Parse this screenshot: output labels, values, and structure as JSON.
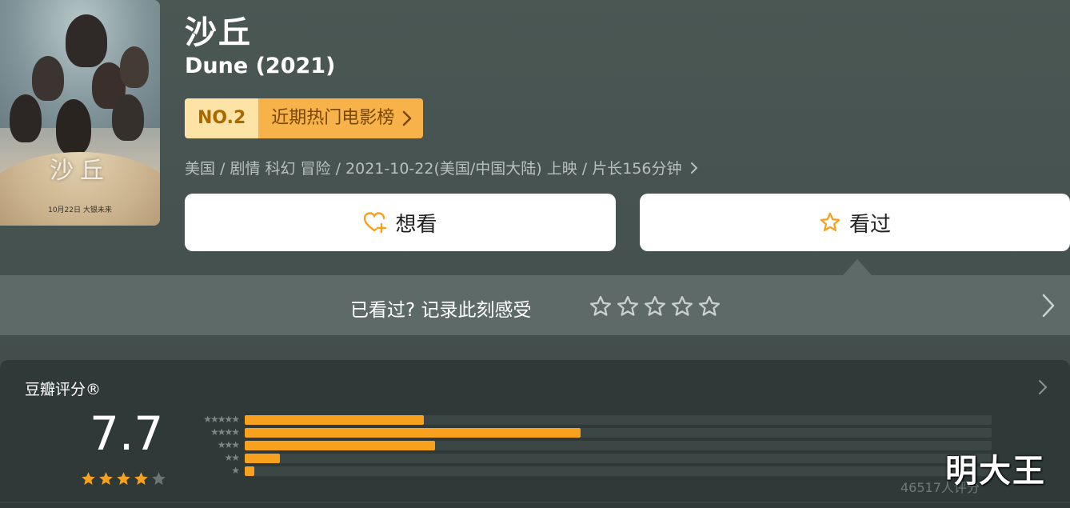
{
  "movie": {
    "title_cn": "沙丘",
    "title_en": "Dune (2021)",
    "poster": {
      "title": "沙丘",
      "date_text": "10月22日 大银未来"
    },
    "rank": {
      "number": "NO.2",
      "list_name": "近期热门电影榜"
    },
    "info": "美国 / 剧情 科幻 冒险 / 2021-10-22(美国/中国大陆) 上映 / 片长156分钟"
  },
  "actions": {
    "want_label": "想看",
    "seen_label": "看过"
  },
  "record": {
    "prompt": "已看过? 记录此刻感受",
    "star_count": 5
  },
  "rating": {
    "label": "豆瓣评分®",
    "score": "7.7",
    "stars_filled": 4,
    "stars_total": 5,
    "total_text": "46517人评分",
    "distribution": [
      {
        "stars": "★★★★★",
        "percent": 24
      },
      {
        "stars": "★★★★",
        "percent": 45
      },
      {
        "stars": "★★★",
        "percent": 25.5
      },
      {
        "stars": "★★",
        "percent": 4.7
      },
      {
        "stars": "★",
        "percent": 1.3
      }
    ]
  },
  "watermark": "明大王",
  "colors": {
    "accent": "#f7a11e",
    "rank_bg": "#fde4a6",
    "list_bg": "#f7b34a"
  }
}
